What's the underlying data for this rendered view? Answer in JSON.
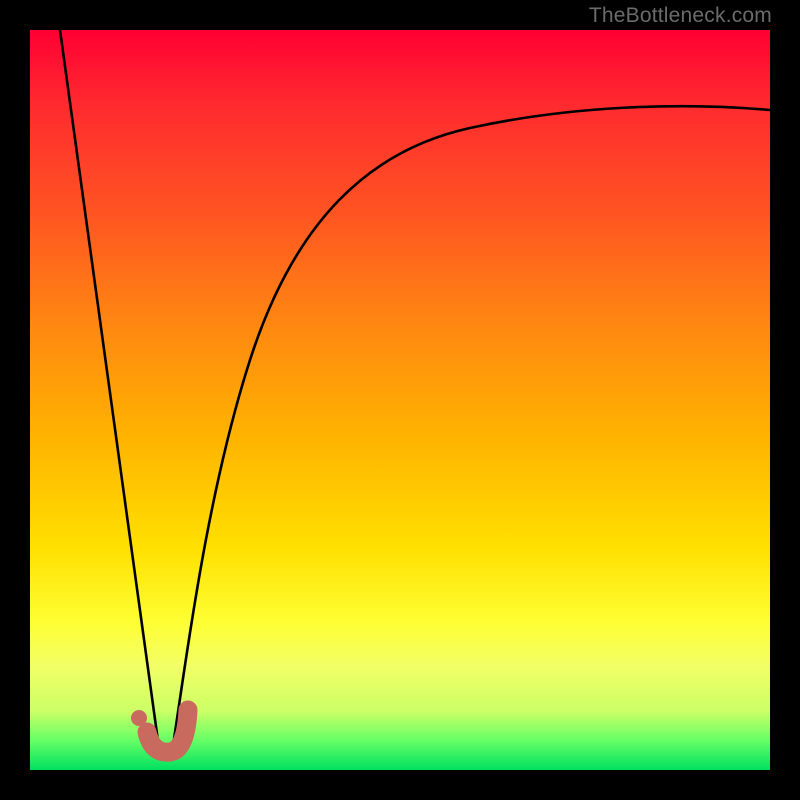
{
  "watermark": {
    "text": "TheBottleneck.com"
  },
  "chart_data": {
    "type": "line",
    "title": "",
    "xlabel": "",
    "ylabel": "",
    "xlim": [
      0,
      100
    ],
    "ylim": [
      0,
      100
    ],
    "grid": false,
    "legend": false,
    "background_gradient": {
      "direction": "vertical",
      "stops": [
        {
          "pos": 0.0,
          "color": "#ff0033"
        },
        {
          "pos": 0.25,
          "color": "#ff5522"
        },
        {
          "pos": 0.55,
          "color": "#ffb300"
        },
        {
          "pos": 0.8,
          "color": "#feff33"
        },
        {
          "pos": 1.0,
          "color": "#00e060"
        }
      ]
    },
    "series": [
      {
        "name": "descending-left-branch",
        "x": [
          4,
          8,
          12,
          16,
          17.5
        ],
        "y": [
          100,
          75,
          50,
          25,
          4
        ],
        "stroke": "#000000",
        "stroke_width": 2.5
      },
      {
        "name": "rising-right-branch",
        "x": [
          19,
          22,
          26,
          30,
          36,
          44,
          54,
          66,
          80,
          100
        ],
        "y": [
          2,
          24,
          44,
          57,
          68,
          77,
          82.5,
          86,
          88,
          89
        ],
        "stroke": "#000000",
        "stroke_width": 2.5
      },
      {
        "name": "marker-j-accent",
        "approx_position": {
          "x": 18,
          "y": 4
        },
        "shape": "J-hook",
        "color": "#c96a5f",
        "stroke_width": 18
      },
      {
        "name": "marker-dot",
        "approx_position": {
          "x": 15.5,
          "y": 6.5
        },
        "shape": "dot",
        "color": "#c96a5f",
        "radius": 8
      }
    ]
  }
}
